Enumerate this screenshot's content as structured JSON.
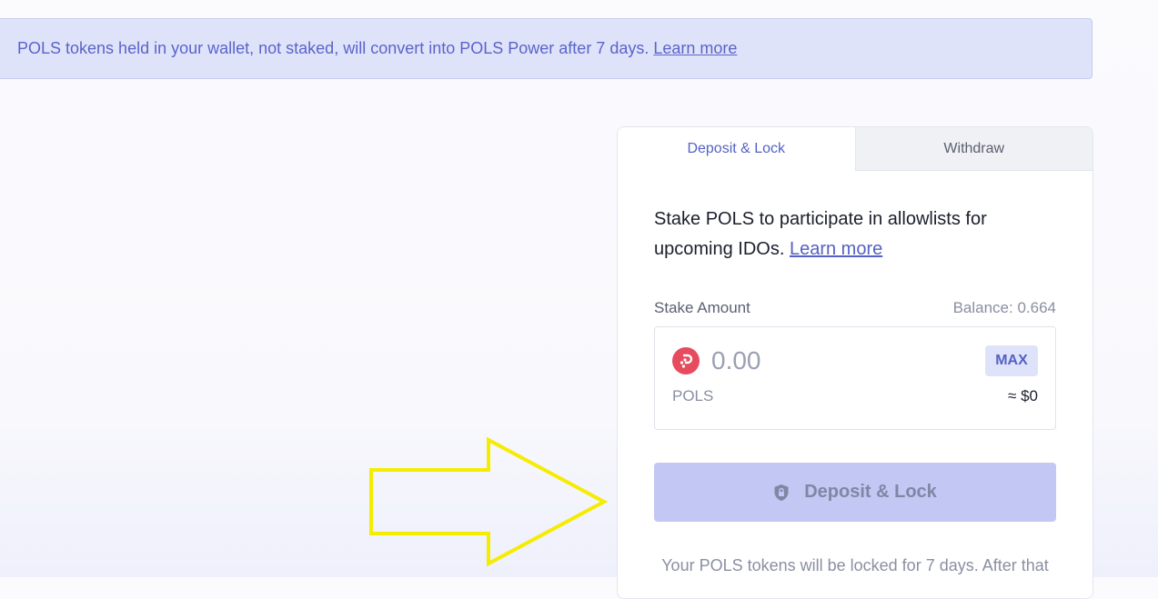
{
  "banner": {
    "text": "POLS tokens held in your wallet, not staked, will convert into POLS Power after 7 days.",
    "link": "Learn more"
  },
  "tabs": [
    {
      "label": "Deposit & Lock",
      "active": true
    },
    {
      "label": "Withdraw",
      "active": false
    }
  ],
  "intro": {
    "text": "Stake POLS to participate in allowlists for upcoming IDOs.",
    "link": "Learn more"
  },
  "stake": {
    "label": "Stake Amount",
    "balance": "Balance: 0.664",
    "placeholder": "0.00",
    "max_label": "MAX",
    "token": "POLS",
    "usd": "≈ $0",
    "token_icon": "pols-logo"
  },
  "deposit_button": {
    "label": "Deposit & Lock",
    "icon": "shield-lock-icon",
    "disabled": true
  },
  "note": "Your POLS tokens will be locked for 7 days. After that",
  "colors": {
    "accent": "#5561c4",
    "banner_bg": "#dfe3fa",
    "button_disabled": "#c2c7f4",
    "pols_red": "#e64c5e",
    "annotation_arrow": "#f5ec00"
  }
}
